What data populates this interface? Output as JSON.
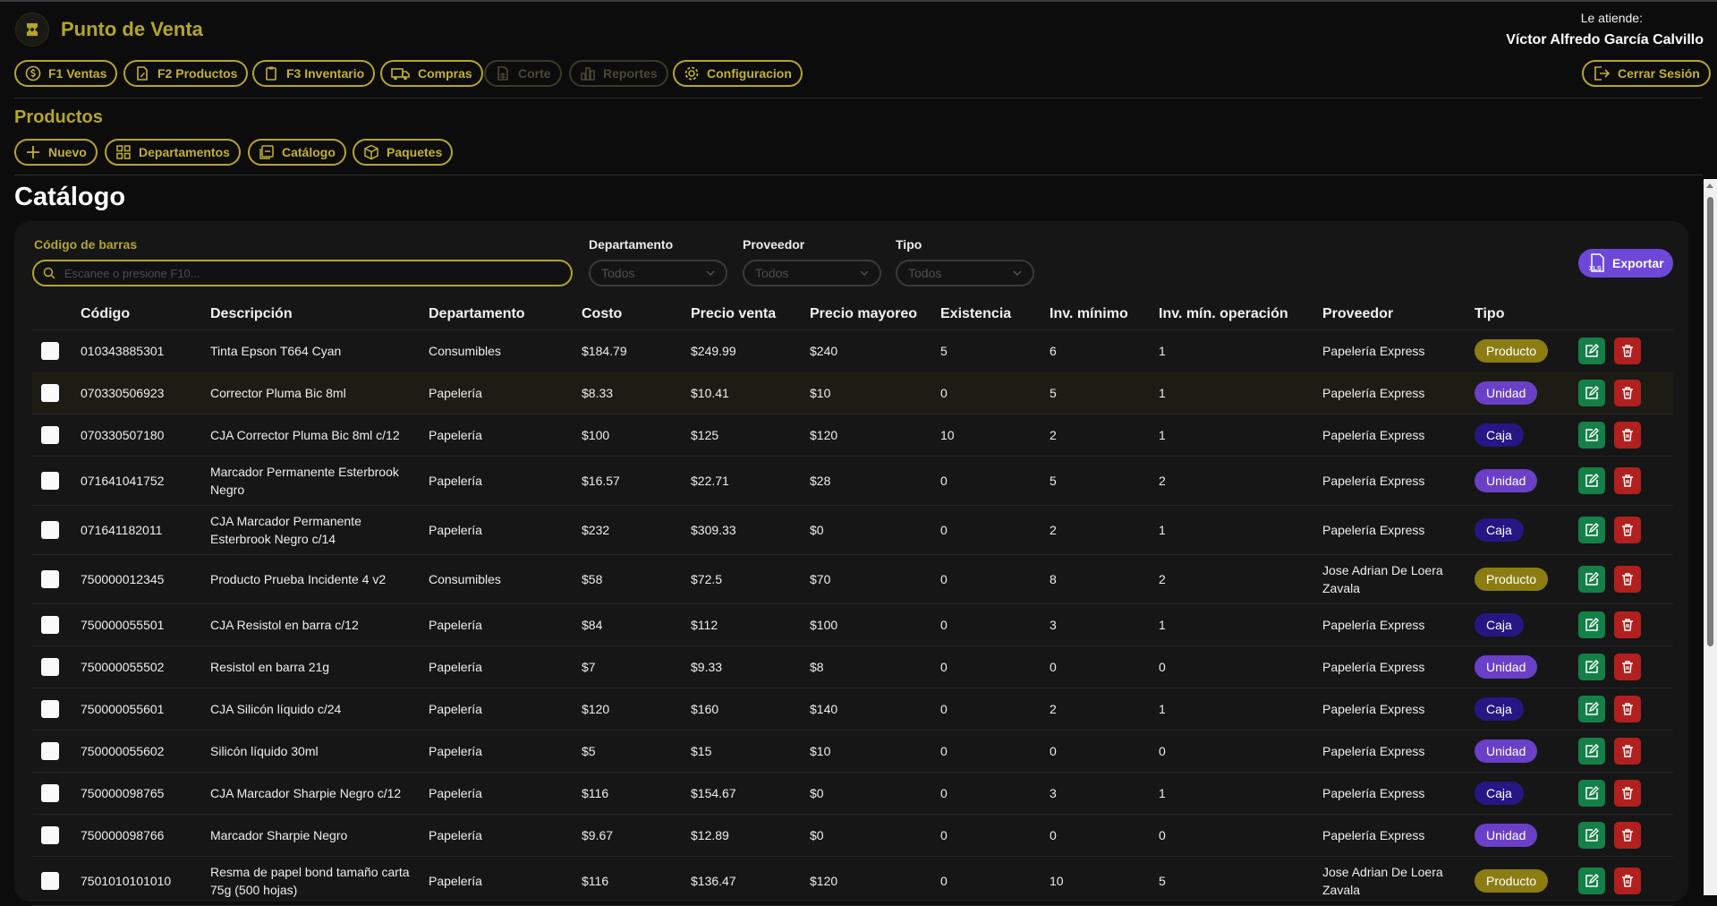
{
  "app": {
    "title": "Punto de Venta"
  },
  "user": {
    "label": "Le atiende:",
    "name": "Víctor Alfredo García Calvillo"
  },
  "nav": [
    {
      "label": "F1 Ventas",
      "icon": "dollar-icon",
      "enabled": true
    },
    {
      "label": "F2 Productos",
      "icon": "document-edit-icon",
      "enabled": true
    },
    {
      "label": "F3 Inventario",
      "icon": "clipboard-icon",
      "enabled": true
    },
    {
      "label": "Compras",
      "icon": "truck-icon",
      "enabled": true
    },
    {
      "label": "Corte",
      "icon": "spreadsheet-icon",
      "enabled": false
    },
    {
      "label": "Reportes",
      "icon": "bar-chart-icon",
      "enabled": false
    },
    {
      "label": "Configuracion",
      "icon": "gear-icon",
      "enabled": true
    }
  ],
  "logout": {
    "label": "Cerrar Sesión"
  },
  "section": {
    "title": "Productos",
    "actions": [
      {
        "label": "Nuevo",
        "icon": "plus-icon"
      },
      {
        "label": "Departamentos",
        "icon": "grid-icon"
      },
      {
        "label": "Catálogo",
        "icon": "catalog-icon"
      },
      {
        "label": "Paquetes",
        "icon": "package-icon"
      }
    ]
  },
  "page": {
    "title": "Catálogo"
  },
  "filters": {
    "barcode": {
      "label": "Código de barras",
      "placeholder": "Escanee o presione F10..."
    },
    "department": {
      "label": "Departamento",
      "value": "Todos"
    },
    "provider": {
      "label": "Proveedor",
      "value": "Todos"
    },
    "type": {
      "label": "Tipo",
      "value": "Todos"
    }
  },
  "export": {
    "label": "Exportar",
    "icon_text": "XLS"
  },
  "colors": {
    "accent": "#b5a52a",
    "badge_producto": "#8b7d12",
    "badge_unidad": "#6a40c8",
    "badge_caja": "#261683",
    "edit": "#148048",
    "delete": "#b21f1f",
    "export": "#6d48d8"
  },
  "table": {
    "columns": [
      "Código",
      "Descripción",
      "Departamento",
      "Costo",
      "Precio venta",
      "Precio mayoreo",
      "Existencia",
      "Inv. mínimo",
      "Inv. mín. operación",
      "Proveedor",
      "Tipo"
    ],
    "rows": [
      {
        "codigo": "010343885301",
        "descripcion": "Tinta Epson T664 Cyan",
        "departamento": "Consumibles",
        "costo": "$184.79",
        "precio_venta": "$249.99",
        "precio_mayoreo": "$240",
        "existencia": "5",
        "inv_minimo": "6",
        "inv_min_op": "1",
        "proveedor": "Papelería Express",
        "tipo": "Producto"
      },
      {
        "codigo": "070330506923",
        "descripcion": "Corrector Pluma Bic 8ml",
        "departamento": "Papelería",
        "costo": "$8.33",
        "precio_venta": "$10.41",
        "precio_mayoreo": "$10",
        "existencia": "0",
        "inv_minimo": "5",
        "inv_min_op": "1",
        "proveedor": "Papelería Express",
        "tipo": "Unidad"
      },
      {
        "codigo": "070330507180",
        "descripcion": "CJA Corrector Pluma Bic 8ml c/12",
        "departamento": "Papelería",
        "costo": "$100",
        "precio_venta": "$125",
        "precio_mayoreo": "$120",
        "existencia": "10",
        "inv_minimo": "2",
        "inv_min_op": "1",
        "proveedor": "Papelería Express",
        "tipo": "Caja"
      },
      {
        "codigo": "071641041752",
        "descripcion": "Marcador Permanente Esterbrook Negro",
        "departamento": "Papelería",
        "costo": "$16.57",
        "precio_venta": "$22.71",
        "precio_mayoreo": "$28",
        "existencia": "0",
        "inv_minimo": "5",
        "inv_min_op": "2",
        "proveedor": "Papelería Express",
        "tipo": "Unidad"
      },
      {
        "codigo": "071641182011",
        "descripcion": "CJA Marcador Permanente Esterbrook Negro c/14",
        "departamento": "Papelería",
        "costo": "$232",
        "precio_venta": "$309.33",
        "precio_mayoreo": "$0",
        "existencia": "0",
        "inv_minimo": "2",
        "inv_min_op": "1",
        "proveedor": "Papelería Express",
        "tipo": "Caja"
      },
      {
        "codigo": "750000012345",
        "descripcion": "Producto Prueba Incidente 4 v2",
        "departamento": "Consumibles",
        "costo": "$58",
        "precio_venta": "$72.5",
        "precio_mayoreo": "$70",
        "existencia": "0",
        "inv_minimo": "8",
        "inv_min_op": "2",
        "proveedor": "Jose Adrian De Loera Zavala",
        "tipo": "Producto"
      },
      {
        "codigo": "750000055501",
        "descripcion": "CJA Resistol en barra c/12",
        "departamento": "Papelería",
        "costo": "$84",
        "precio_venta": "$112",
        "precio_mayoreo": "$100",
        "existencia": "0",
        "inv_minimo": "3",
        "inv_min_op": "1",
        "proveedor": "Papelería Express",
        "tipo": "Caja"
      },
      {
        "codigo": "750000055502",
        "descripcion": "Resistol en barra 21g",
        "departamento": "Papelería",
        "costo": "$7",
        "precio_venta": "$9.33",
        "precio_mayoreo": "$8",
        "existencia": "0",
        "inv_minimo": "0",
        "inv_min_op": "0",
        "proveedor": "Papelería Express",
        "tipo": "Unidad"
      },
      {
        "codigo": "750000055601",
        "descripcion": "CJA Silicón líquido c/24",
        "departamento": "Papelería",
        "costo": "$120",
        "precio_venta": "$160",
        "precio_mayoreo": "$140",
        "existencia": "0",
        "inv_minimo": "2",
        "inv_min_op": "1",
        "proveedor": "Papelería Express",
        "tipo": "Caja"
      },
      {
        "codigo": "750000055602",
        "descripcion": "Silicón líquido 30ml",
        "departamento": "Papelería",
        "costo": "$5",
        "precio_venta": "$15",
        "precio_mayoreo": "$10",
        "existencia": "0",
        "inv_minimo": "0",
        "inv_min_op": "0",
        "proveedor": "Papelería Express",
        "tipo": "Unidad"
      },
      {
        "codigo": "750000098765",
        "descripcion": "CJA Marcador Sharpie Negro c/12",
        "departamento": "Papelería",
        "costo": "$116",
        "precio_venta": "$154.67",
        "precio_mayoreo": "$0",
        "existencia": "0",
        "inv_minimo": "3",
        "inv_min_op": "1",
        "proveedor": "Papelería Express",
        "tipo": "Caja"
      },
      {
        "codigo": "750000098766",
        "descripcion": "Marcador Sharpie Negro",
        "departamento": "Papelería",
        "costo": "$9.67",
        "precio_venta": "$12.89",
        "precio_mayoreo": "$0",
        "existencia": "0",
        "inv_minimo": "0",
        "inv_min_op": "0",
        "proveedor": "Papelería Express",
        "tipo": "Unidad"
      },
      {
        "codigo": "7501010101010",
        "descripcion": "Resma de papel bond tamaño carta 75g (500 hojas)",
        "departamento": "Papelería",
        "costo": "$116",
        "precio_venta": "$136.47",
        "precio_mayoreo": "$120",
        "existencia": "0",
        "inv_minimo": "10",
        "inv_min_op": "5",
        "proveedor": "Jose Adrian De Loera Zavala",
        "tipo": "Producto"
      }
    ]
  }
}
